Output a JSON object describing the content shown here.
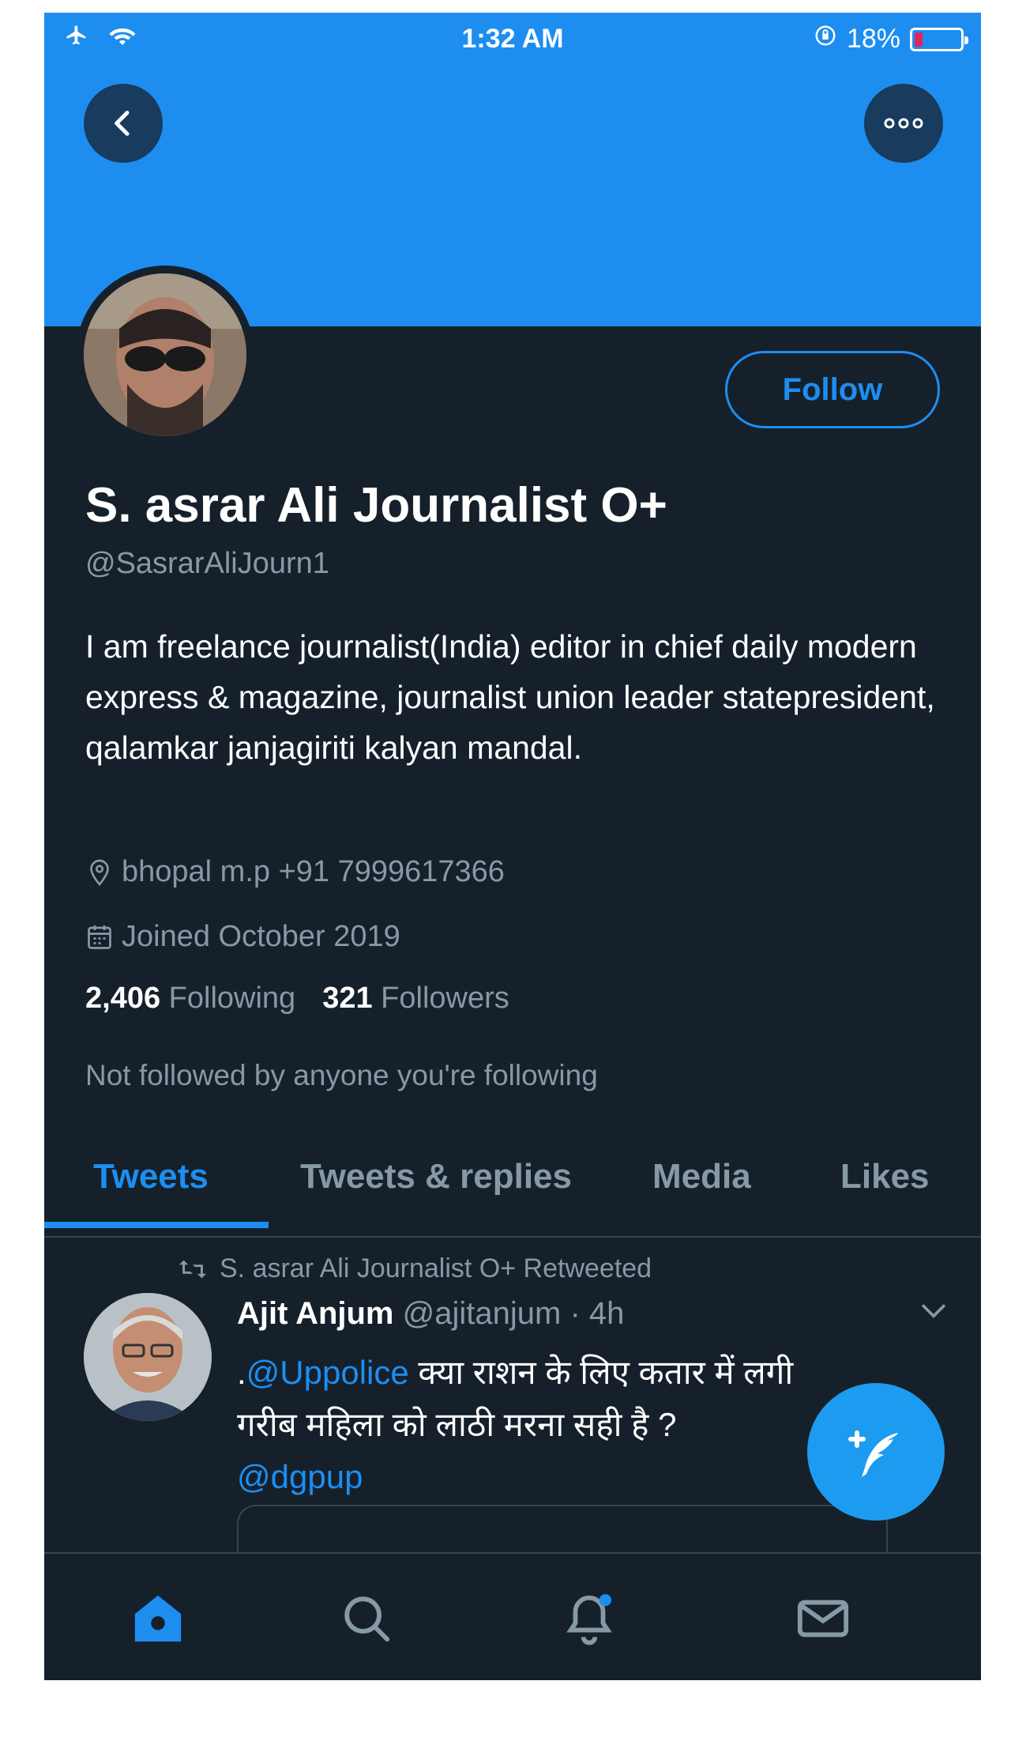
{
  "status_bar": {
    "time": "1:32 AM",
    "battery_percent": "18%",
    "battery_level": 0.18
  },
  "header": {
    "back_icon": "chevron-left-icon",
    "more_icon": "more-dots-icon"
  },
  "profile": {
    "follow_label": "Follow",
    "name": "S. asrar Ali Journalist O+",
    "handle": "@SasrarAliJourn1",
    "bio": "I am freelance journalist(India) editor in chief daily modern express & magazine, journalist union leader statepresident, qalamkar janjagiriti kalyan mandal.",
    "location": "bhopal m.p +91 7999617366",
    "joined": "Joined October 2019",
    "following_count": "2,406",
    "following_label": "Following",
    "followers_count": "321",
    "followers_label": "Followers",
    "not_followed": "Not followed by anyone you're following"
  },
  "tabs": [
    {
      "label": "Tweets",
      "active": true
    },
    {
      "label": "Tweets & replies",
      "active": false
    },
    {
      "label": "Media",
      "active": false
    },
    {
      "label": "Likes",
      "active": false
    }
  ],
  "tweet": {
    "retweet_context": "S. asrar Ali Journalist O+ Retweeted",
    "author_name": "Ajit Anjum",
    "author_handle": "@ajitanjum",
    "time": "· 4h",
    "text_prefix": ".",
    "mention1": "@Uppolice",
    "text_body": " क्या राशन के लिए कतार में लगी गरीब महिला को लाठी मरना सही है ?",
    "mention2": "@dgpup"
  },
  "bottom_nav": [
    "home-icon",
    "search-icon",
    "notifications-icon",
    "messages-icon"
  ],
  "colors": {
    "accent": "#1d8ef0",
    "background": "#15202b",
    "secondary_text": "#8899a6"
  }
}
